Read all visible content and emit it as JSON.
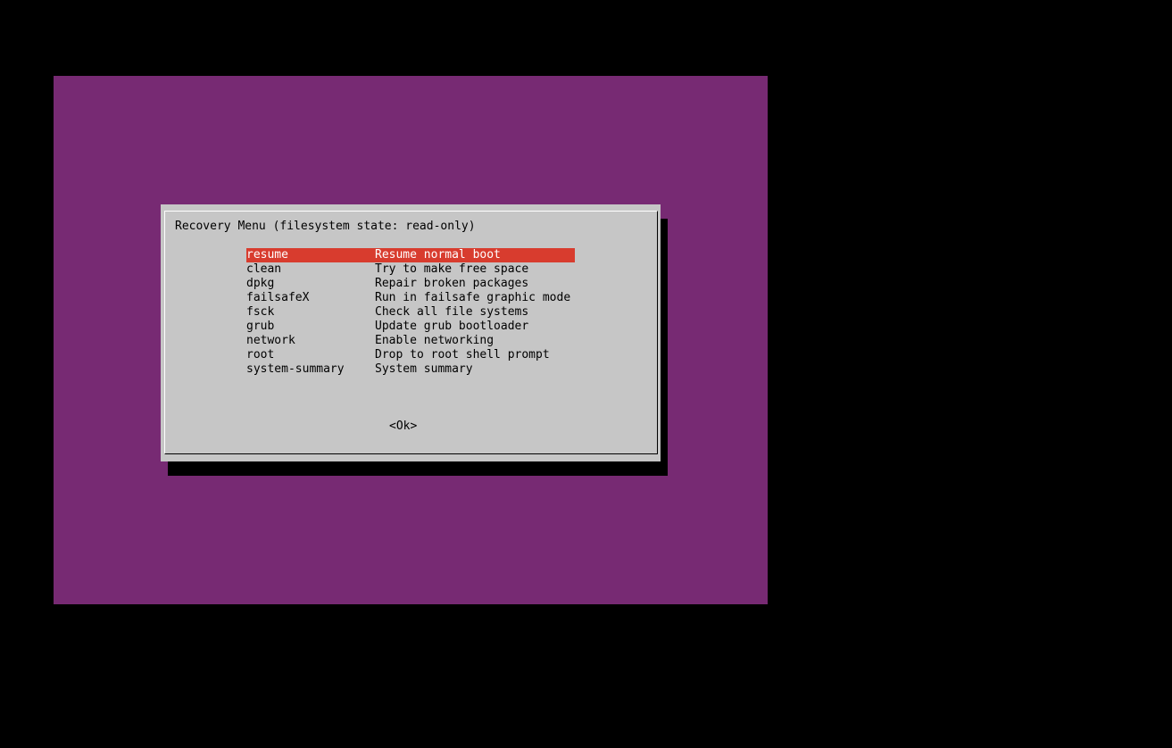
{
  "dialog": {
    "title": "Recovery Menu (filesystem state: read-only)",
    "ok_label": "<Ok>"
  },
  "menu": {
    "selected_index": 0,
    "items": [
      {
        "tag": "resume",
        "description": "Resume normal boot"
      },
      {
        "tag": "clean",
        "description": "Try to make free space"
      },
      {
        "tag": "dpkg",
        "description": "Repair broken packages"
      },
      {
        "tag": "failsafeX",
        "description": "Run in failsafe graphic mode"
      },
      {
        "tag": "fsck",
        "description": "Check all file systems"
      },
      {
        "tag": "grub",
        "description": "Update grub bootloader"
      },
      {
        "tag": "network",
        "description": "Enable networking"
      },
      {
        "tag": "root",
        "description": "Drop to root shell prompt"
      },
      {
        "tag": "system-summary",
        "description": "System summary"
      }
    ]
  },
  "colors": {
    "screen_background": "#772a73",
    "dialog_background": "#c6c6c6",
    "selection_background": "#d83c2e",
    "selection_text": "#ffffff"
  }
}
